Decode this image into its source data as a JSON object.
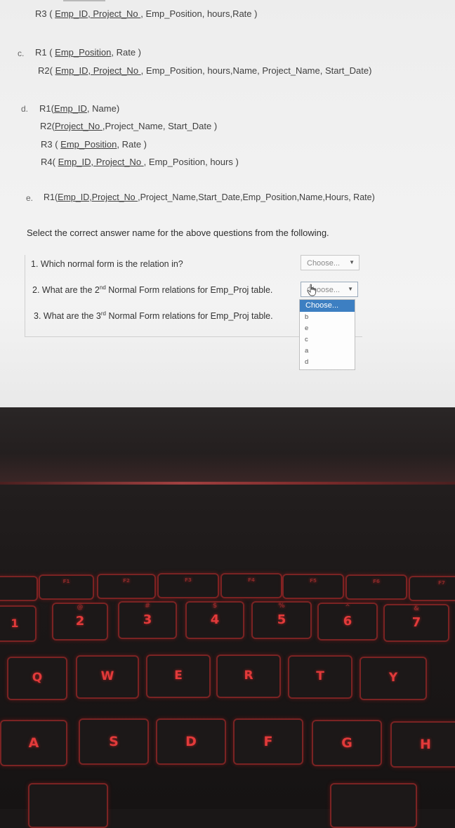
{
  "relations": {
    "top_line": {
      "prefix": "R3 ( ",
      "key": "Emp_ID, Project_No ",
      "rest": ", Emp_Position, hours,Rate )"
    },
    "c": {
      "marker": "c.",
      "r1": {
        "prefix": "R1 ( ",
        "key": "Emp_Position",
        "rest": ", Rate )"
      },
      "r2": {
        "prefix": "R2( ",
        "key": "Emp_ID, Project_No ",
        "rest": ", Emp_Position, hours,Name, Project_Name, Start_Date)"
      }
    },
    "d": {
      "marker": "d.",
      "r1": {
        "prefix": "R1(",
        "key": "Emp_ID",
        "rest": ", Name)"
      },
      "r2": {
        "prefix": "R2(",
        "key": "Project_No ",
        "rest": ",Project_Name, Start_Date )"
      },
      "r3": {
        "prefix": "R3 ( ",
        "key": "Emp_Position",
        "rest": ", Rate )"
      },
      "r4": {
        "prefix": "R4( ",
        "key": "Emp_ID, Project_No ",
        "rest": ", Emp_Position, hours )"
      }
    },
    "e": {
      "marker": "e.",
      "r1": {
        "prefix": "R1(",
        "key": "Emp_ID,Project_No ",
        "rest": ",Project_Name,Start_Date,Emp_Position,Name,Hours, Rate)"
      }
    }
  },
  "instruction": "Select the correct answer name for the above questions from the following.",
  "questions": [
    {
      "text": "1. Which normal form is the relation in?",
      "select_value": "Choose..."
    },
    {
      "text_before": "2. What are the 2",
      "sup": "nd",
      "text_after": " Normal Form relations for Emp_Proj table.",
      "select_value": "Choose..."
    },
    {
      "text_before": "3. What are the 3",
      "sup": "rd",
      "text_after": " Normal Form relations for Emp_Proj table."
    }
  ],
  "dropdown": {
    "options": [
      "Choose...",
      "b",
      "e",
      "c",
      "a",
      "d"
    ],
    "selected_index": 0
  },
  "icons": {
    "select_arrow": "▼",
    "cursor": "hand-pointer-icon"
  },
  "keyboard": {
    "fn_row": [
      "F1",
      "F2",
      "F3",
      "F4",
      "F5",
      "F6",
      "F7"
    ],
    "number_row": [
      "1",
      "2",
      "3",
      "4",
      "5",
      "6",
      "7"
    ],
    "number_symbols": [
      "@",
      "#",
      "$",
      "%",
      "^",
      "&"
    ],
    "top_row": [
      "Q",
      "W",
      "E",
      "R",
      "T",
      "Y"
    ],
    "home_row": [
      "A",
      "S",
      "D",
      "F",
      "G",
      "H"
    ]
  },
  "colors": {
    "key_backlight": "#e23a3a",
    "select_highlight": "#3d7fc2"
  }
}
